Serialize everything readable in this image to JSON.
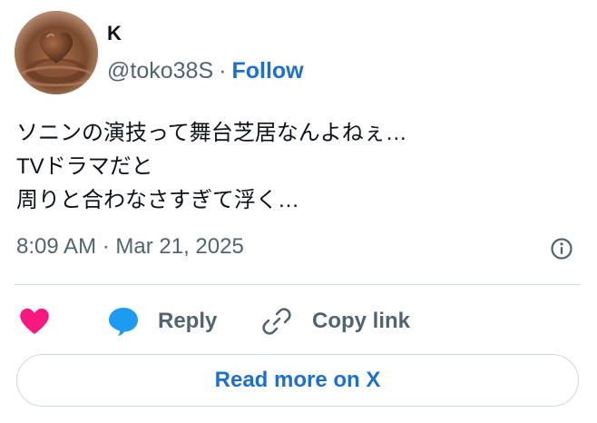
{
  "author": {
    "name": "K",
    "handle": "@toko38S",
    "separator": "·",
    "follow_label": "Follow"
  },
  "tweet": {
    "lines": [
      "ソニンの演技って舞台芝居なんよねぇ…",
      "TVドラマだと",
      "周りと合わなさすぎて浮く…"
    ],
    "timestamp": "8:09 AM · Mar 21, 2025"
  },
  "actions": {
    "like_icon": "heart-icon",
    "reply_label": "Reply",
    "copy_label": "Copy link"
  },
  "read_more_label": "Read more on X",
  "colors": {
    "accent": "#1d6fd1",
    "like": "#f91880",
    "reply_icon": "#1d9bf0",
    "muted": "#536471",
    "divider": "#cfd9de"
  }
}
